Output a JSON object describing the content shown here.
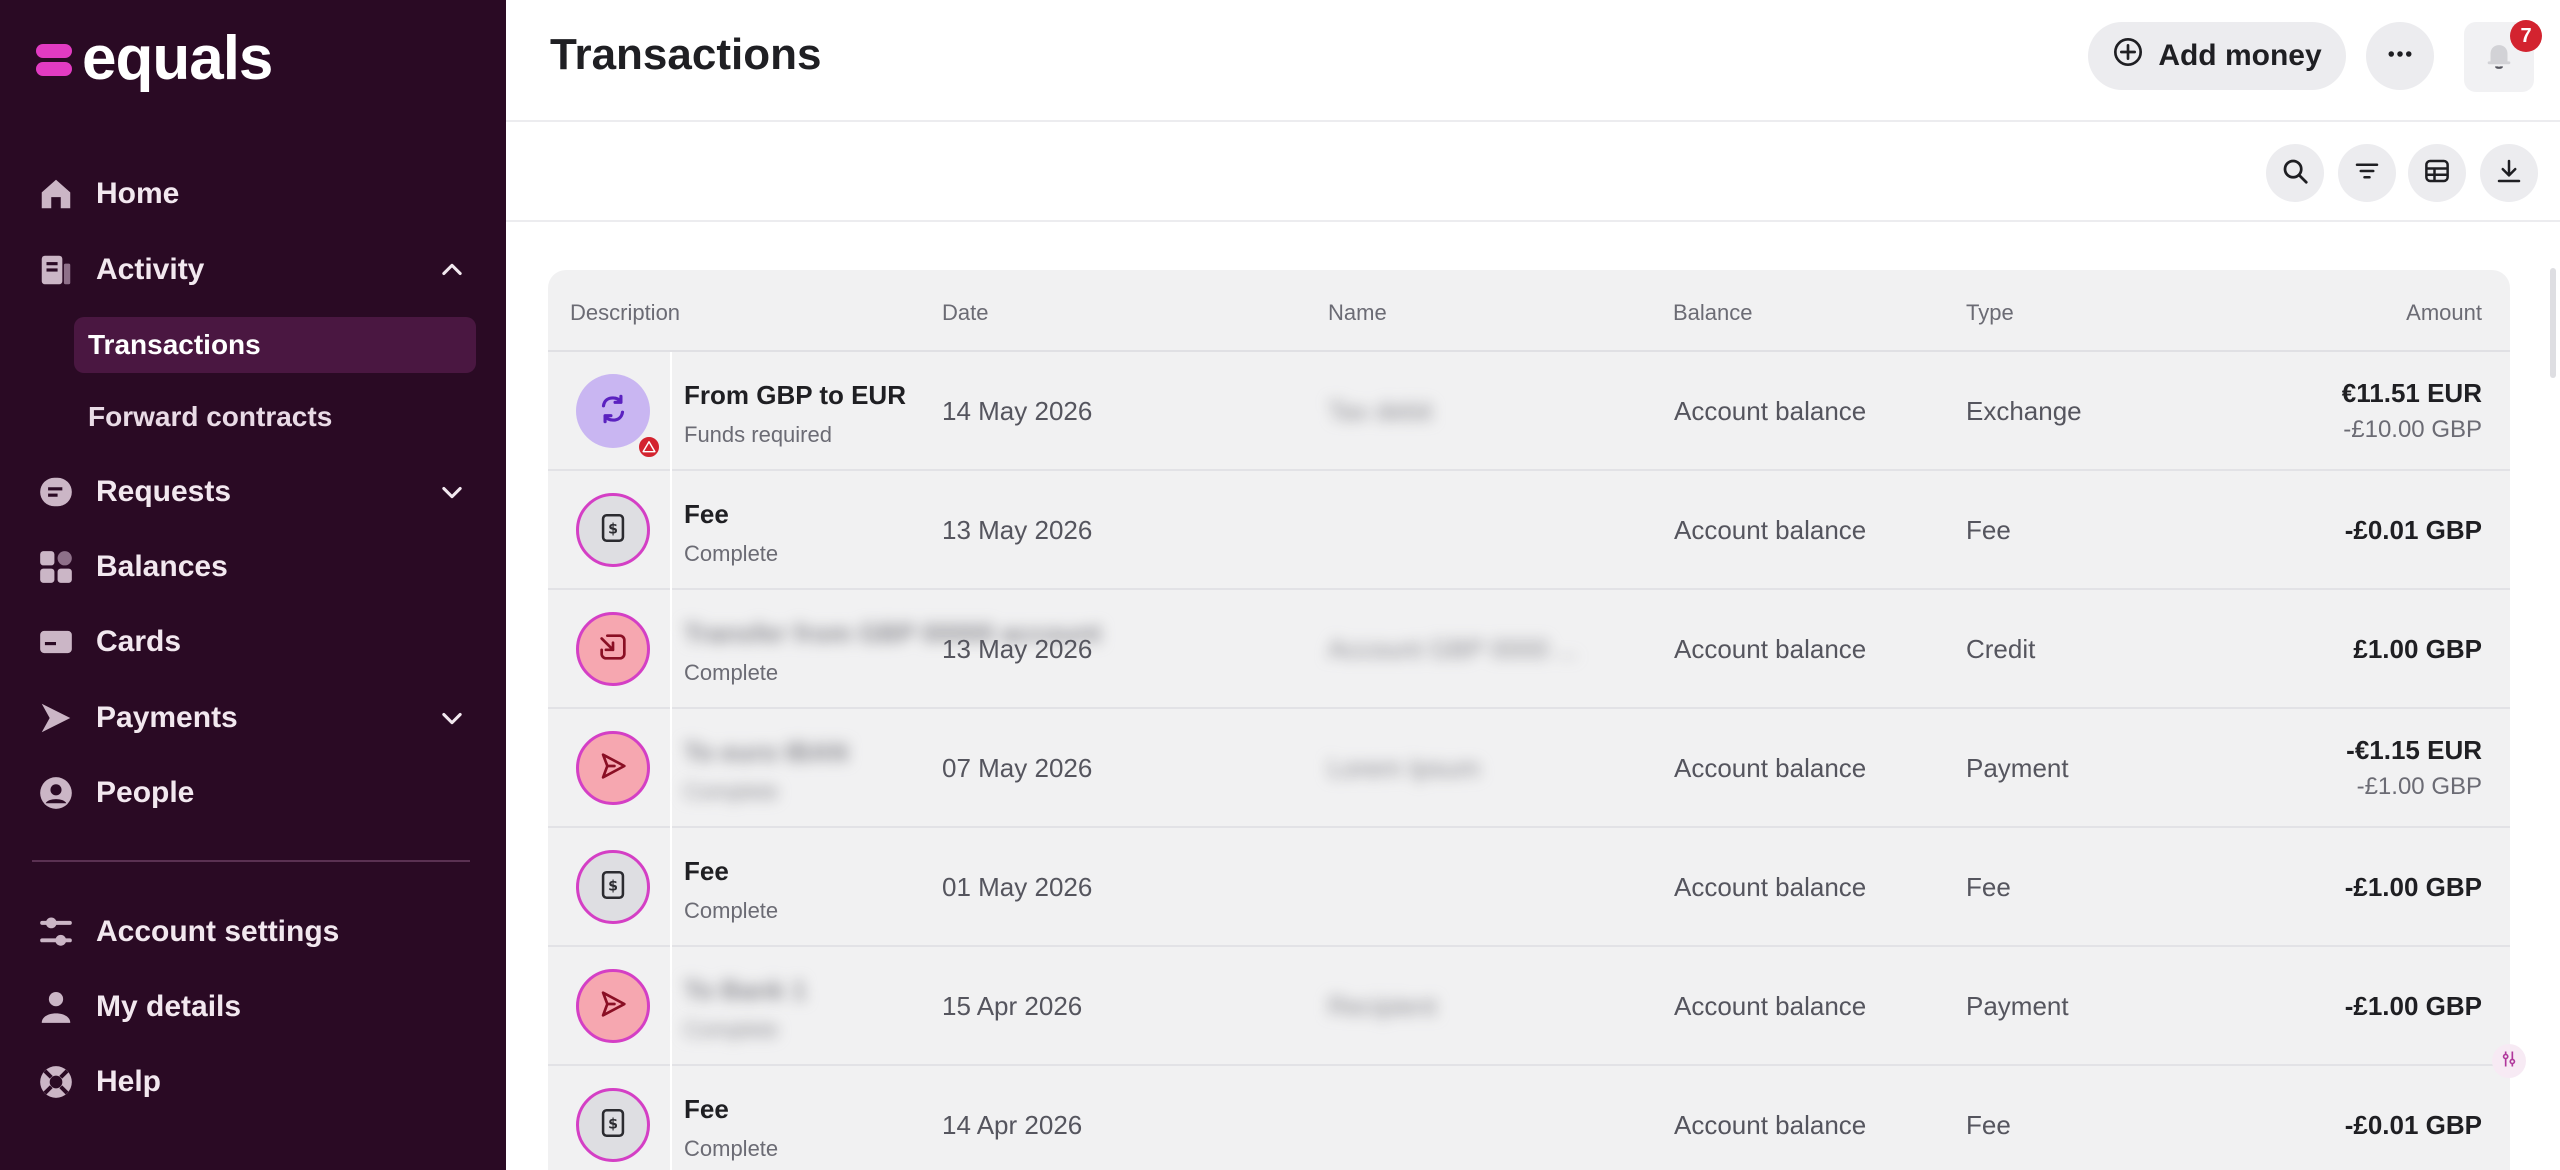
{
  "brand": {
    "name": "equals"
  },
  "sidebar": {
    "items": [
      {
        "label": "Home",
        "icon": "home-icon"
      },
      {
        "label": "Activity",
        "icon": "activity-icon",
        "expanded": true
      },
      {
        "label": "Requests",
        "icon": "requests-icon"
      },
      {
        "label": "Balances",
        "icon": "balances-icon"
      },
      {
        "label": "Cards",
        "icon": "cards-icon"
      },
      {
        "label": "Payments",
        "icon": "payments-icon"
      },
      {
        "label": "People",
        "icon": "people-icon"
      }
    ],
    "subitems": [
      {
        "label": "Transactions",
        "active": true
      },
      {
        "label": "Forward contracts",
        "active": false
      }
    ],
    "bottom_items": [
      {
        "label": "Account settings",
        "icon": "settings-icon"
      },
      {
        "label": "My details",
        "icon": "person-icon"
      },
      {
        "label": "Help",
        "icon": "help-icon"
      }
    ]
  },
  "header": {
    "title": "Transactions",
    "add_money_label": "Add money",
    "notification_count": "7"
  },
  "table": {
    "columns": [
      "Description",
      "Date",
      "Name",
      "Balance",
      "Type",
      "Amount"
    ],
    "rows": [
      {
        "kind": "exchange",
        "description": "From GBP to EUR",
        "status": "Funds required",
        "date": "14 May 2026",
        "name": "Tax debit",
        "name_blurred": true,
        "balance": "Account balance",
        "type": "Exchange",
        "amount": "€11.51 EUR",
        "amount_secondary": "-£10.00 GBP"
      },
      {
        "kind": "fee",
        "description": "Fee",
        "status": "Complete",
        "date": "13 May 2026",
        "name": "",
        "balance": "Account balance",
        "type": "Fee",
        "amount": "-£0.01 GBP",
        "amount_secondary": ""
      },
      {
        "kind": "credit",
        "description": "Transfer from GBP 00000 account",
        "description_blurred": true,
        "status": "Complete",
        "date": "13 May 2026",
        "name": "Account GBP 0000 ...",
        "name_blurred": true,
        "balance": "Account balance",
        "type": "Credit",
        "amount": "£1.00 GBP",
        "amount_secondary": ""
      },
      {
        "kind": "payment",
        "description": "To euro IBAN",
        "description_blurred": true,
        "status": "Complete",
        "status_blurred": true,
        "date": "07 May 2026",
        "name": "Lorem Ipsum",
        "name_blurred": true,
        "balance": "Account balance",
        "type": "Payment",
        "amount": "-€1.15 EUR",
        "amount_secondary": "-£1.00 GBP"
      },
      {
        "kind": "fee",
        "description": "Fee",
        "status": "Complete",
        "date": "01 May 2026",
        "name": "",
        "balance": "Account balance",
        "type": "Fee",
        "amount": "-£1.00 GBP",
        "amount_secondary": ""
      },
      {
        "kind": "payment",
        "description": "To Bank 1",
        "description_blurred": true,
        "status": "Complete",
        "status_blurred": true,
        "date": "15 Apr 2026",
        "name": "Recipient",
        "name_blurred": true,
        "balance": "Account balance",
        "type": "Payment",
        "amount": "-£1.00 GBP",
        "amount_secondary": ""
      },
      {
        "kind": "fee",
        "description": "Fee",
        "status": "Complete",
        "date": "14 Apr 2026",
        "name": "",
        "balance": "Account balance",
        "type": "Fee",
        "amount": "-£0.01 GBP",
        "amount_secondary": ""
      }
    ]
  },
  "colors": {
    "sidebar_bg": "#2a0a24",
    "brand_accent": "#e23bc2",
    "badge": "#d3232f"
  }
}
